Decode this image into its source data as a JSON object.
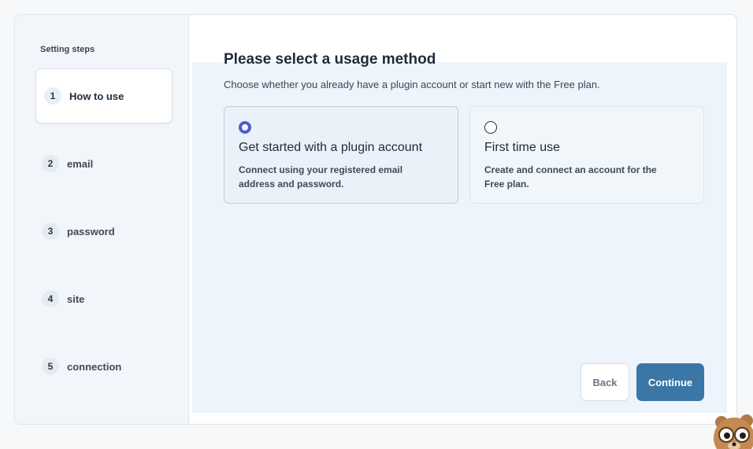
{
  "sidebar": {
    "heading": "Setting steps",
    "steps": [
      {
        "number": "1",
        "label": "How to use",
        "active": true
      },
      {
        "number": "2",
        "label": "email",
        "active": false
      },
      {
        "number": "3",
        "label": "password",
        "active": false
      },
      {
        "number": "4",
        "label": "site",
        "active": false
      },
      {
        "number": "5",
        "label": "connection",
        "active": false
      }
    ]
  },
  "main": {
    "title": "Please select a usage method",
    "subtitle": "Choose whether you already have a plugin account or start new with the Free plan.",
    "options": [
      {
        "title": "Get started with a plugin account",
        "description": "Connect using your registered email address and password.",
        "selected": true
      },
      {
        "title": "First time use",
        "description": "Create and connect an account for the Free plan.",
        "selected": false
      }
    ],
    "back_label": "Back",
    "continue_label": "Continue"
  },
  "colors": {
    "accent": "#3b77a6",
    "radio_selected": "#4b5fce",
    "sidebar_bg": "#f2f6fa",
    "content_bg": "#eef4fb"
  },
  "icons": {
    "mascot": "bear-mascot-icon"
  }
}
